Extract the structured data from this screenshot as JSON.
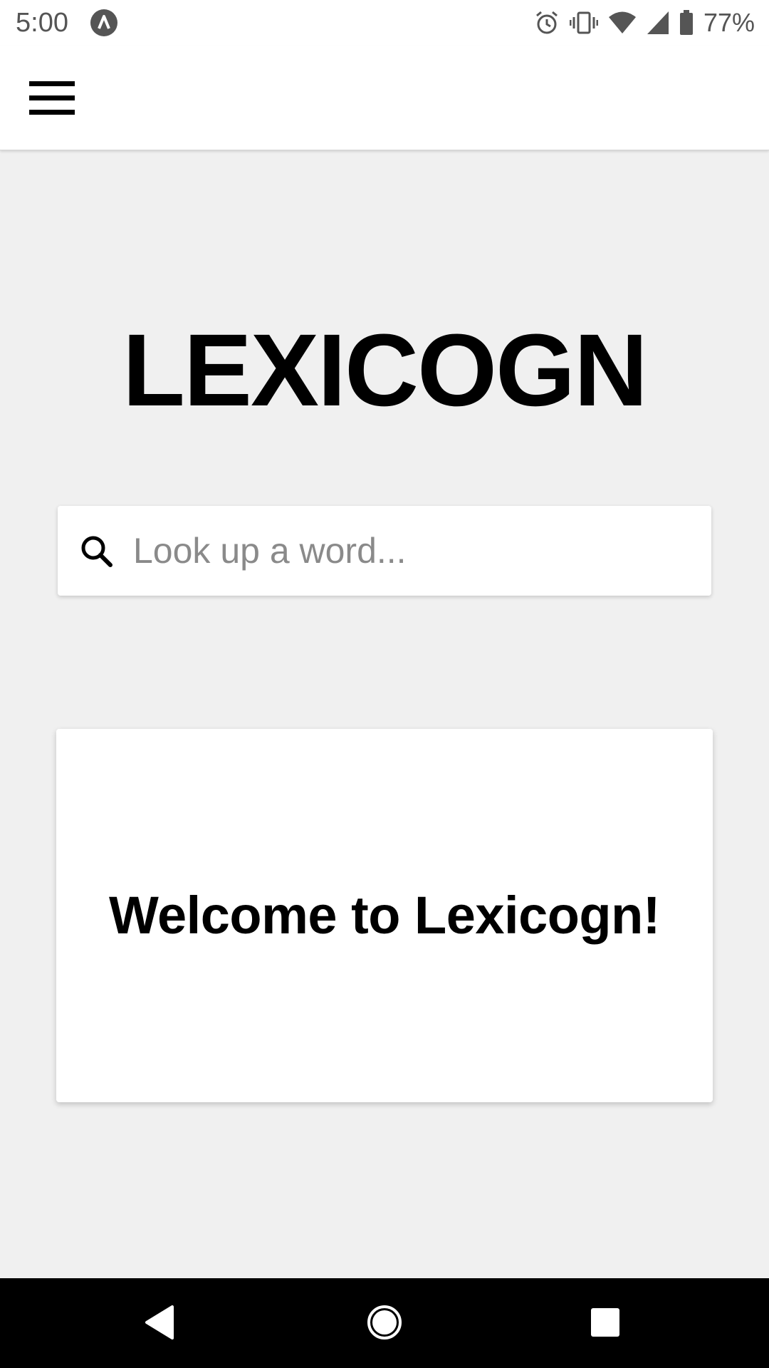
{
  "status_bar": {
    "time": "5:00",
    "battery_percent": "77%",
    "icons": [
      "app-notification-icon",
      "alarm-icon",
      "vibrate-icon",
      "wifi-icon",
      "cell-signal-icon",
      "battery-icon"
    ]
  },
  "app_bar": {
    "menu_icon": "hamburger-menu-icon"
  },
  "main": {
    "logo_title": "LEXICOGN",
    "search": {
      "icon": "search-icon",
      "placeholder": "Look up a word...",
      "value": ""
    },
    "welcome_card": {
      "text": "Welcome to Lexicogn!"
    }
  },
  "nav_bar": {
    "buttons": [
      "back-icon",
      "home-icon",
      "recents-icon"
    ]
  },
  "colors": {
    "background": "#f0f0f0",
    "surface": "#ffffff",
    "text": "#000000",
    "placeholder": "#8a8a8a",
    "status_text": "#555555",
    "nav_bar": "#000000"
  }
}
